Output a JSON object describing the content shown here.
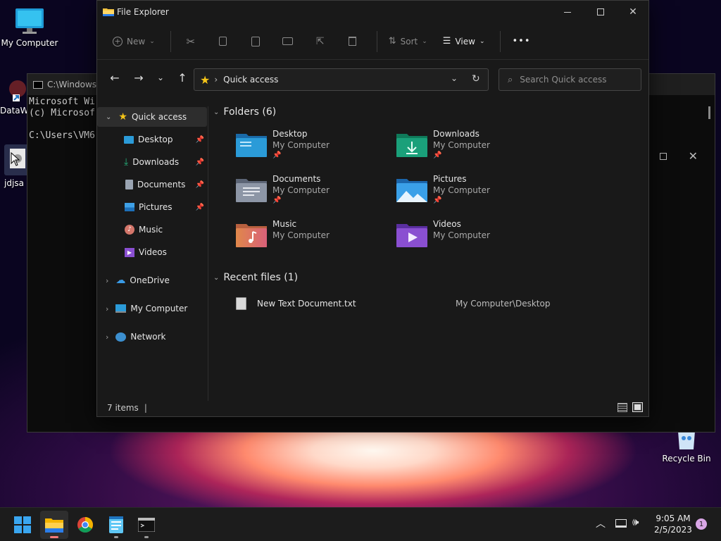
{
  "desktop": {
    "icons": [
      {
        "label": "My Computer"
      },
      {
        "label": "DataW"
      },
      {
        "label": "jdjsa"
      },
      {
        "label": "Recycle Bin"
      }
    ]
  },
  "terminal": {
    "title": "C:\\Windows\\",
    "lines": [
      "Microsoft Wi",
      "(c) Microsof",
      "",
      "C:\\Users\\VM6"
    ]
  },
  "explorer": {
    "title": "File Explorer",
    "toolbar": {
      "new_label": "New",
      "sort_label": "Sort",
      "view_label": "View",
      "more_label": "•••"
    },
    "address": "Quick access",
    "search_placeholder": "Search Quick access",
    "nav": [
      {
        "label": "Quick access",
        "selected": true
      },
      {
        "label": "Desktop",
        "pinned": true
      },
      {
        "label": "Downloads",
        "pinned": true
      },
      {
        "label": "Documents",
        "pinned": true
      },
      {
        "label": "Pictures",
        "pinned": true
      },
      {
        "label": "Music"
      },
      {
        "label": "Videos"
      },
      {
        "label": "OneDrive"
      },
      {
        "label": "My Computer"
      },
      {
        "label": "Network"
      }
    ],
    "folders_header": "Folders (6)",
    "folders": [
      {
        "name": "Desktop",
        "location": "My Computer",
        "pinned": true
      },
      {
        "name": "Downloads",
        "location": "My Computer",
        "pinned": true
      },
      {
        "name": "Documents",
        "location": "My Computer",
        "pinned": true
      },
      {
        "name": "Pictures",
        "location": "My Computer",
        "pinned": true
      },
      {
        "name": "Music",
        "location": "My Computer"
      },
      {
        "name": "Videos",
        "location": "My Computer"
      }
    ],
    "recent_header": "Recent files (1)",
    "recent": [
      {
        "name": "New Text Document.txt",
        "location": "My Computer\\Desktop"
      }
    ],
    "status": "7 items"
  },
  "taskbar": {
    "time": "9:05 AM",
    "date": "2/5/2023",
    "notification_count": "1"
  }
}
